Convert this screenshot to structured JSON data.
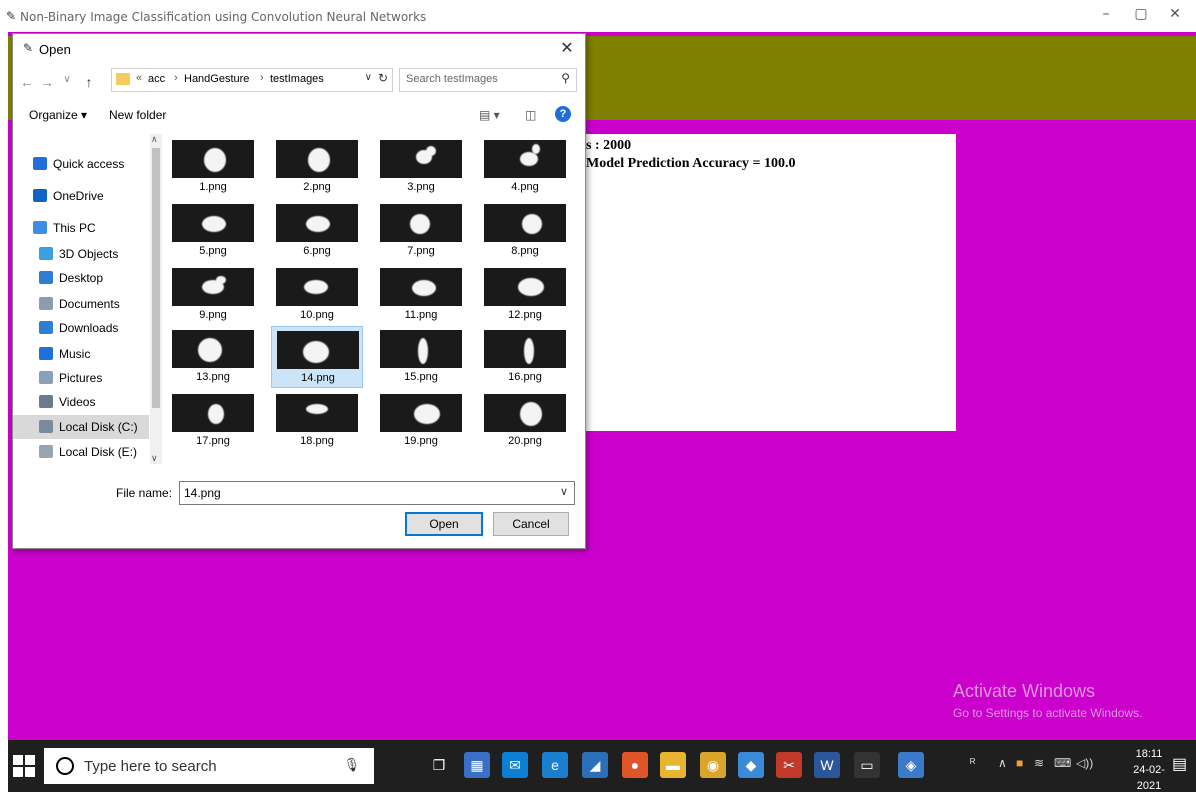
{
  "app": {
    "title": "Non-Binary Image Classification using Convolution Neural Networks",
    "controls": {
      "minimize": "–",
      "maximize": "▢",
      "close": "✕"
    },
    "panel_lines": [
      "s : 2000",
      "Model Prediction Accuracy = 100.0"
    ],
    "watermark": {
      "line1": "Activate Windows",
      "line2": "Go to Settings to activate Windows."
    },
    "colors": {
      "background": "#cc00cc",
      "band": "#808000"
    }
  },
  "dialog": {
    "title": "Open",
    "close": "✕",
    "nav": {
      "back": "←",
      "forward": "→",
      "recent": "∨",
      "up": "↑"
    },
    "breadcrumb": {
      "prefix": "«",
      "items": [
        "acc",
        "HandGesture",
        "testImages"
      ],
      "separator": "›"
    },
    "search_placeholder": "Search testImages",
    "toolbar": {
      "organize": "Organize ▾",
      "new_folder": "New folder"
    },
    "sidebar": [
      {
        "label": "Quick access",
        "icon": "star-icon",
        "color": "#1e6fd9"
      },
      {
        "label": "OneDrive",
        "icon": "cloud-icon",
        "color": "#0e63c4"
      },
      {
        "label": "This PC",
        "icon": "computer-icon",
        "color": "#3a8ee6"
      },
      {
        "label": "3D Objects",
        "icon": "cube-icon",
        "color": "#3aa0e0"
      },
      {
        "label": "Desktop",
        "icon": "desktop-icon",
        "color": "#2d7fd4"
      },
      {
        "label": "Documents",
        "icon": "document-icon",
        "color": "#8c9cb0"
      },
      {
        "label": "Downloads",
        "icon": "download-icon",
        "color": "#2d7fd4"
      },
      {
        "label": "Music",
        "icon": "music-icon",
        "color": "#1e6fd9"
      },
      {
        "label": "Pictures",
        "icon": "pictures-icon",
        "color": "#8aa0b8"
      },
      {
        "label": "Videos",
        "icon": "video-icon",
        "color": "#6b7a8c"
      },
      {
        "label": "Local Disk (C:)",
        "icon": "disk-icon",
        "color": "#7a8a9a"
      },
      {
        "label": "Local Disk (E:)",
        "icon": "disk-icon",
        "color": "#9aa4ae"
      }
    ],
    "files": [
      "1.png",
      "2.png",
      "3.png",
      "4.png",
      "5.png",
      "6.png",
      "7.png",
      "8.png",
      "9.png",
      "10.png",
      "11.png",
      "12.png",
      "13.png",
      "14.png",
      "15.png",
      "16.png",
      "17.png",
      "18.png",
      "19.png",
      "20.png"
    ],
    "selected_file": "14.png",
    "file_name_label": "File name:",
    "file_name_value": "14.png",
    "open_button": "Open",
    "cancel_button": "Cancel"
  },
  "taskbar": {
    "search_placeholder": "Type here to search",
    "time": "18:11",
    "date": "24-02-2021",
    "apps": [
      {
        "name": "task-view-icon",
        "color": "#1f1f1f",
        "glyph": "❐"
      },
      {
        "name": "store-icon",
        "color": "#3a6fc8",
        "glyph": "▦"
      },
      {
        "name": "mail-icon",
        "color": "#0a7fd4",
        "glyph": "✉"
      },
      {
        "name": "edge-icon",
        "color": "#1b7fd0",
        "glyph": "e"
      },
      {
        "name": "app-icon",
        "color": "#2a6fb8",
        "glyph": "◢"
      },
      {
        "name": "firefox-icon",
        "color": "#e0542a",
        "glyph": "●"
      },
      {
        "name": "explorer-icon",
        "color": "#e8b531",
        "glyph": "▬"
      },
      {
        "name": "chrome-icon",
        "color": "#d9a52b",
        "glyph": "◉"
      },
      {
        "name": "paint-icon",
        "color": "#3a8ad8",
        "glyph": "◆"
      },
      {
        "name": "snip-icon",
        "color": "#c0392b",
        "glyph": "✂"
      },
      {
        "name": "word-icon",
        "color": "#2b579a",
        "glyph": "W"
      },
      {
        "name": "terminal-icon",
        "color": "#333333",
        "glyph": "▭"
      },
      {
        "name": "python-icon",
        "color": "#3a7ac8",
        "glyph": "◈"
      }
    ]
  }
}
